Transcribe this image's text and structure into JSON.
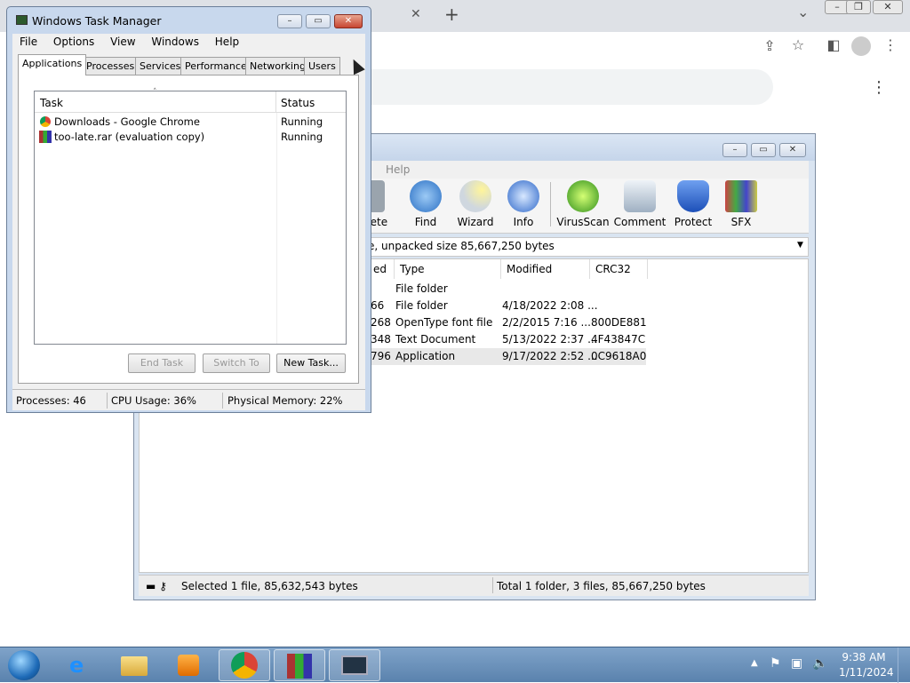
{
  "chrome": {
    "new_tab_glyph": "+",
    "close_tab_glyph": "✕",
    "menu_glyph": "⋮"
  },
  "task_manager": {
    "title": "Windows Task Manager",
    "menu": [
      "File",
      "Options",
      "View",
      "Windows",
      "Help"
    ],
    "tabs": [
      "Applications",
      "Processes",
      "Services",
      "Performance",
      "Networking",
      "Users"
    ],
    "columns": {
      "task": "Task",
      "status": "Status"
    },
    "tasks": [
      {
        "name": "Downloads - Google Chrome",
        "status": "Running"
      },
      {
        "name": "too-late.rar (evaluation copy)",
        "status": "Running"
      }
    ],
    "buttons": {
      "end": "End Task",
      "switch": "Switch To",
      "new": "New Task..."
    },
    "status": {
      "processes": "Processes: 46",
      "cpu": "CPU Usage: 36%",
      "memory": "Physical Memory: 22%"
    }
  },
  "winrar": {
    "menu_help": "Help",
    "tools": [
      "elete",
      "Find",
      "Wizard",
      "Info",
      "VirusScan",
      "Comment",
      "Protect",
      "SFX"
    ],
    "path_text": "e, unpacked size 85,667,250 bytes",
    "columns": {
      "packed": "ed",
      "type": "Type",
      "modified": "Modified",
      "crc": "CRC32"
    },
    "rows": [
      {
        "packed": "",
        "type": "File folder",
        "modified": "",
        "crc": ""
      },
      {
        "packed": "66",
        "type": "File folder",
        "modified": "4/18/2022 2:08 ...",
        "crc": ""
      },
      {
        "packed": "268",
        "type": "OpenType font file",
        "modified": "2/2/2015 7:16 ...",
        "crc": "800DE881"
      },
      {
        "packed": "348",
        "type": "Text Document",
        "modified": "5/13/2022 2:37 ...",
        "crc": "4F43847C"
      },
      {
        "packed": "796",
        "type": "Application",
        "modified": "9/17/2022 2:52 ...",
        "crc": "0C9618A0"
      }
    ],
    "status_left": "Selected 1 file, 85,632,543 bytes",
    "status_right": "Total 1 folder, 3 files, 85,667,250 bytes"
  },
  "taskbar": {
    "time": "9:38 AM",
    "date": "1/11/2024",
    "icons": [
      "start-orb-icon",
      "internet-explorer-icon",
      "explorer-folder-icon",
      "media-player-icon",
      "chrome-icon",
      "winrar-icon",
      "task-manager-icon"
    ]
  }
}
